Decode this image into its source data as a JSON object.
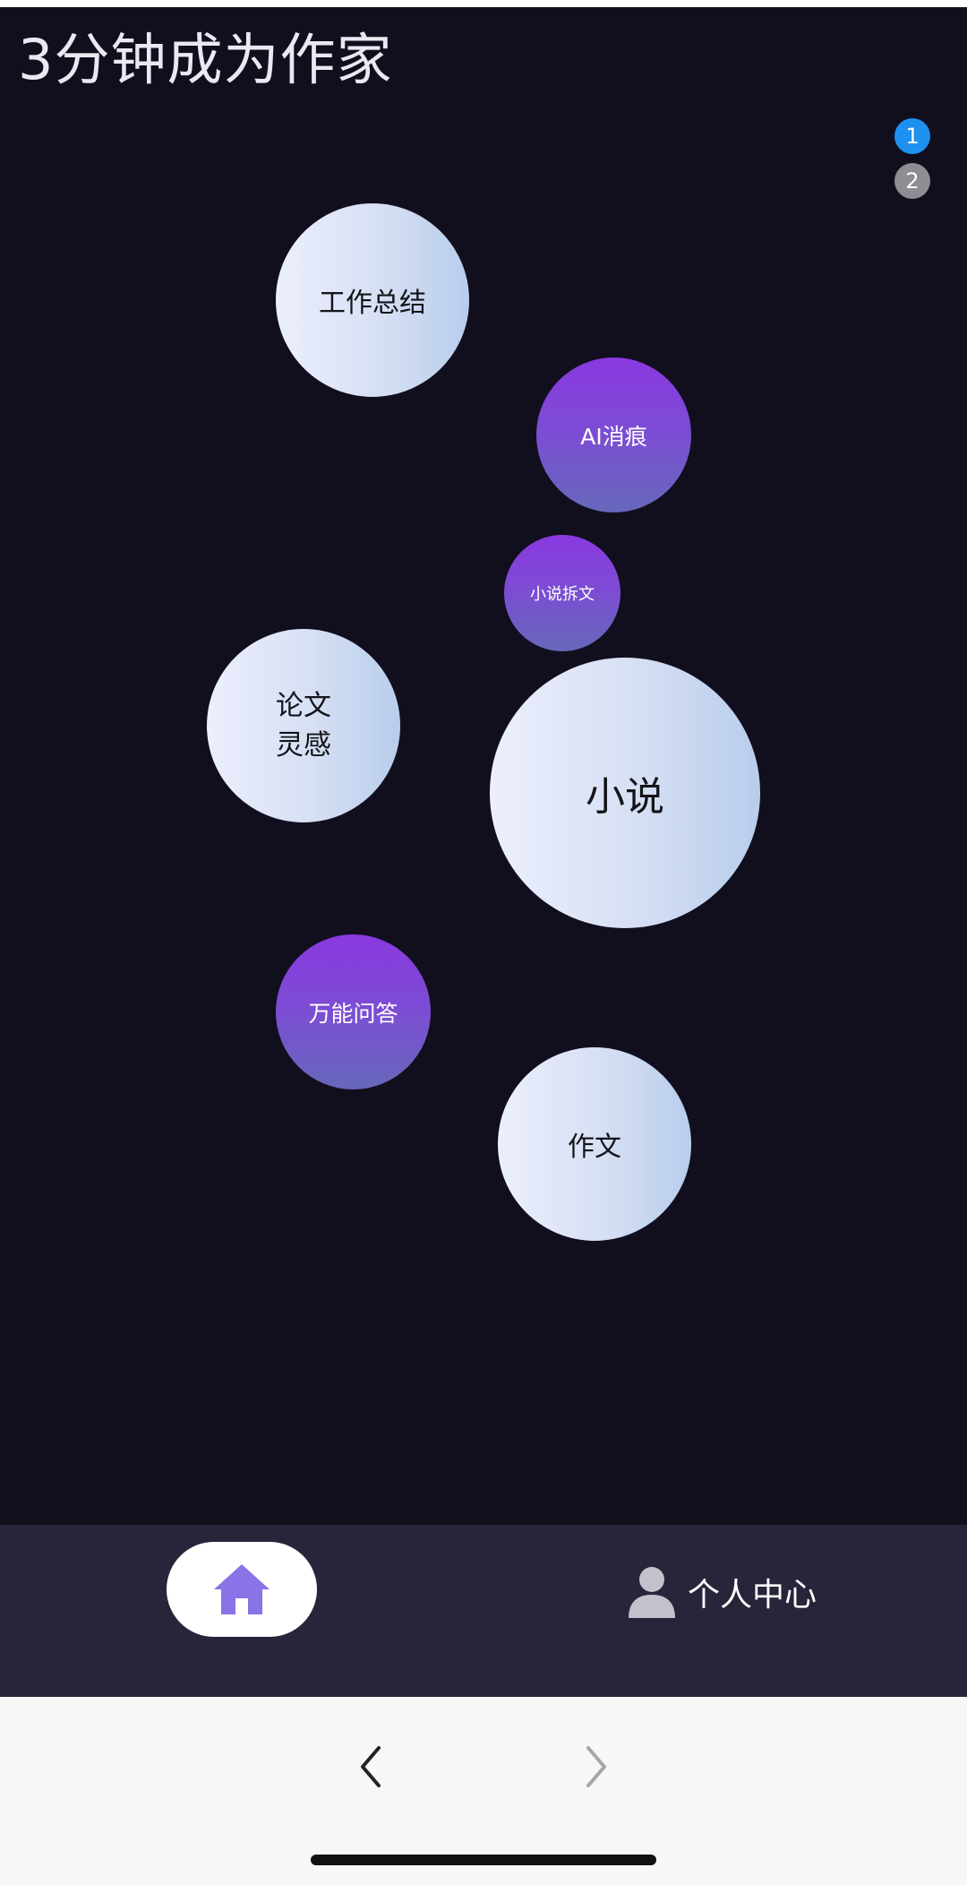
{
  "header": {
    "title": "3分钟成为作家"
  },
  "pager": {
    "pages": [
      {
        "label": "1",
        "active": true
      },
      {
        "label": "2",
        "active": false
      }
    ],
    "active_color": "#1e90f0",
    "inactive_color": "#8d8d93"
  },
  "bubbles": [
    {
      "id": "work-summary",
      "label": "工作总结",
      "style": "light"
    },
    {
      "id": "ai-trace-removal",
      "label": "AI消痕",
      "style": "purple"
    },
    {
      "id": "novel-breakdown",
      "label": "小说拆文",
      "style": "purple"
    },
    {
      "id": "thesis-inspiration",
      "label": "论文\n灵感",
      "style": "light"
    },
    {
      "id": "novel",
      "label": "小说",
      "style": "light"
    },
    {
      "id": "universal-qa",
      "label": "万能问答",
      "style": "purple"
    },
    {
      "id": "essay",
      "label": "作文",
      "style": "light"
    }
  ],
  "tabbar": {
    "home_icon": "home-icon",
    "home_icon_color": "#8a73e6",
    "profile_icon": "user-icon",
    "profile_label": "个人中心"
  },
  "browser_nav": {
    "back_icon": "chevron-left-icon",
    "forward_icon": "chevron-right-icon"
  },
  "colors": {
    "background": "#110f1e",
    "tabbar": "#28243a",
    "purple_bubble": "#8a39df",
    "light_bubble": "#dfe6f8"
  }
}
